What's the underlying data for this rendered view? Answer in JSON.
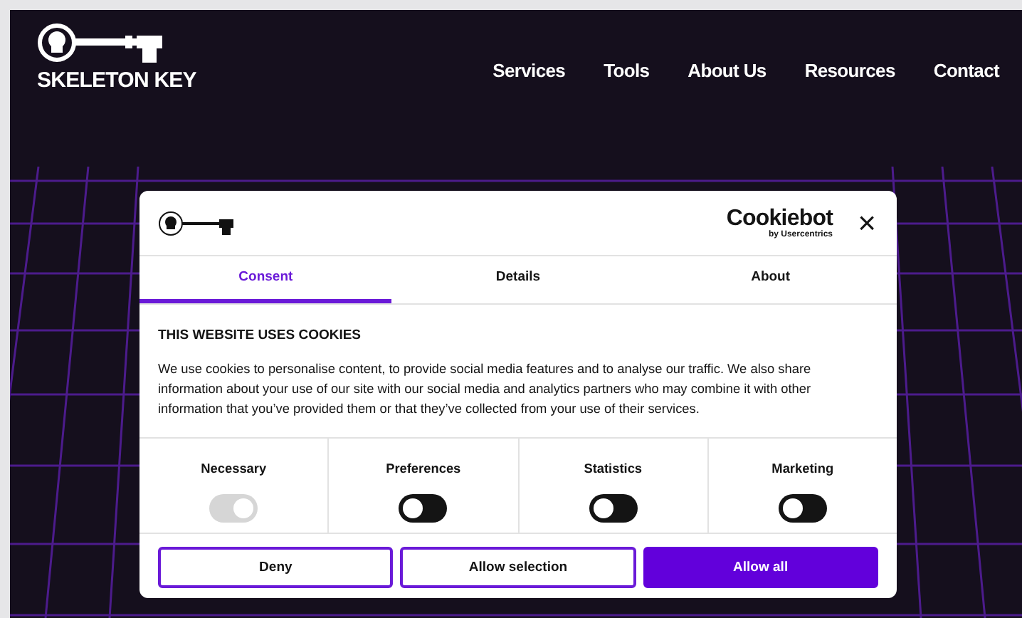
{
  "site": {
    "logo_text": "SKELETON KEY",
    "nav": [
      "Services",
      "Tools",
      "About Us",
      "Resources",
      "Contact"
    ]
  },
  "dialog": {
    "brand": {
      "name": "Cookiebot",
      "byline": "by Usercentrics"
    },
    "close": "×",
    "tabs": [
      {
        "label": "Consent",
        "selected": true
      },
      {
        "label": "Details",
        "selected": false
      },
      {
        "label": "About",
        "selected": false
      }
    ],
    "heading": "THIS WEBSITE USES COOKIES",
    "body": "We use cookies to personalise content, to provide social media features and to analyse our traffic. We also share information about your use of our site with our social media and analytics partners who may combine it with other information that you’ve provided them or that they’ve collected from your use of their services.",
    "categories": [
      {
        "label": "Necessary",
        "on": true,
        "disabled": true
      },
      {
        "label": "Preferences",
        "on": false,
        "disabled": false
      },
      {
        "label": "Statistics",
        "on": false,
        "disabled": false
      },
      {
        "label": "Marketing",
        "on": false,
        "disabled": false
      }
    ],
    "buttons": [
      {
        "label": "Deny",
        "kind": "outline"
      },
      {
        "label": "Allow selection",
        "kind": "outline"
      },
      {
        "label": "Allow all",
        "kind": "primary"
      }
    ]
  }
}
